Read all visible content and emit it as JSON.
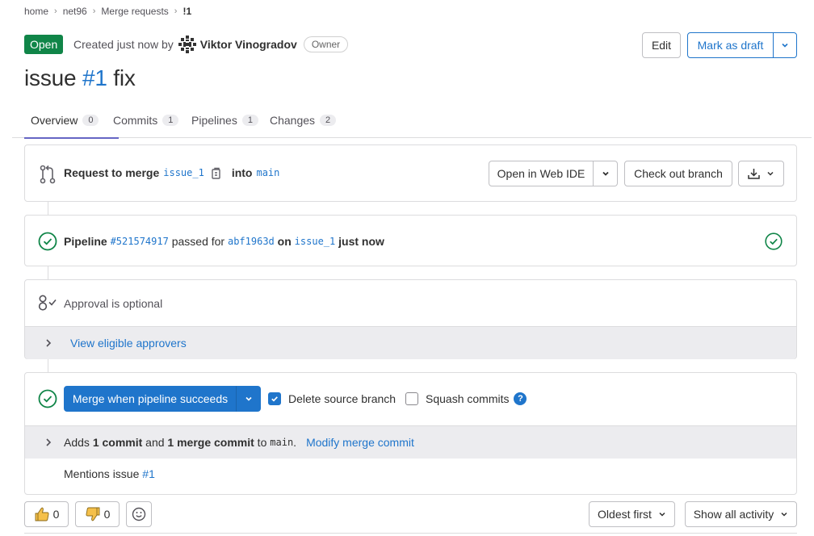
{
  "breadcrumb": {
    "items": [
      "home",
      "net96",
      "Merge requests",
      "!1"
    ]
  },
  "header": {
    "status": "Open",
    "created_prefix": "Created just now by",
    "author": "Viktor Vinogradov",
    "role": "Owner",
    "edit_label": "Edit",
    "draft_label": "Mark as draft",
    "title_prefix": "issue ",
    "title_ref": "#1",
    "title_suffix": " fix"
  },
  "tabs": [
    {
      "label": "Overview",
      "count": "0"
    },
    {
      "label": "Commits",
      "count": "1"
    },
    {
      "label": "Pipelines",
      "count": "1"
    },
    {
      "label": "Changes",
      "count": "2"
    }
  ],
  "merge_request": {
    "label": "Request to merge",
    "source_branch": "issue_1",
    "into": "into",
    "target_branch": "main",
    "open_ide_label": "Open in Web IDE",
    "checkout_label": "Check out branch"
  },
  "pipeline": {
    "label": "Pipeline",
    "id": "#521574917",
    "status": "passed for",
    "commit": "abf1963d",
    "on": "on",
    "branch": "issue_1",
    "time": "just now"
  },
  "approval": {
    "text": "Approval is optional",
    "link": "View eligible approvers"
  },
  "merge": {
    "button_label": "Merge when pipeline succeeds",
    "delete_source_label": "Delete source branch",
    "delete_source_checked": true,
    "squash_label": "Squash commits",
    "squash_checked": false,
    "adds_prefix": "Adds ",
    "commit_count": "1 commit",
    "and": " and ",
    "merge_commit_count": "1 merge commit",
    "to": " to ",
    "target_branch": "main",
    "period": ".",
    "modify_link": "Modify merge commit",
    "mentions_prefix": "Mentions issue ",
    "mentions_ref": "#1"
  },
  "bottom": {
    "thumbs_up_count": "0",
    "thumbs_down_count": "0",
    "sort_label": "Oldest first",
    "filter_label": "Show all activity"
  },
  "colors": {
    "accent": "#1f75cb",
    "success": "#108548",
    "tab_active": "#6666c4"
  }
}
